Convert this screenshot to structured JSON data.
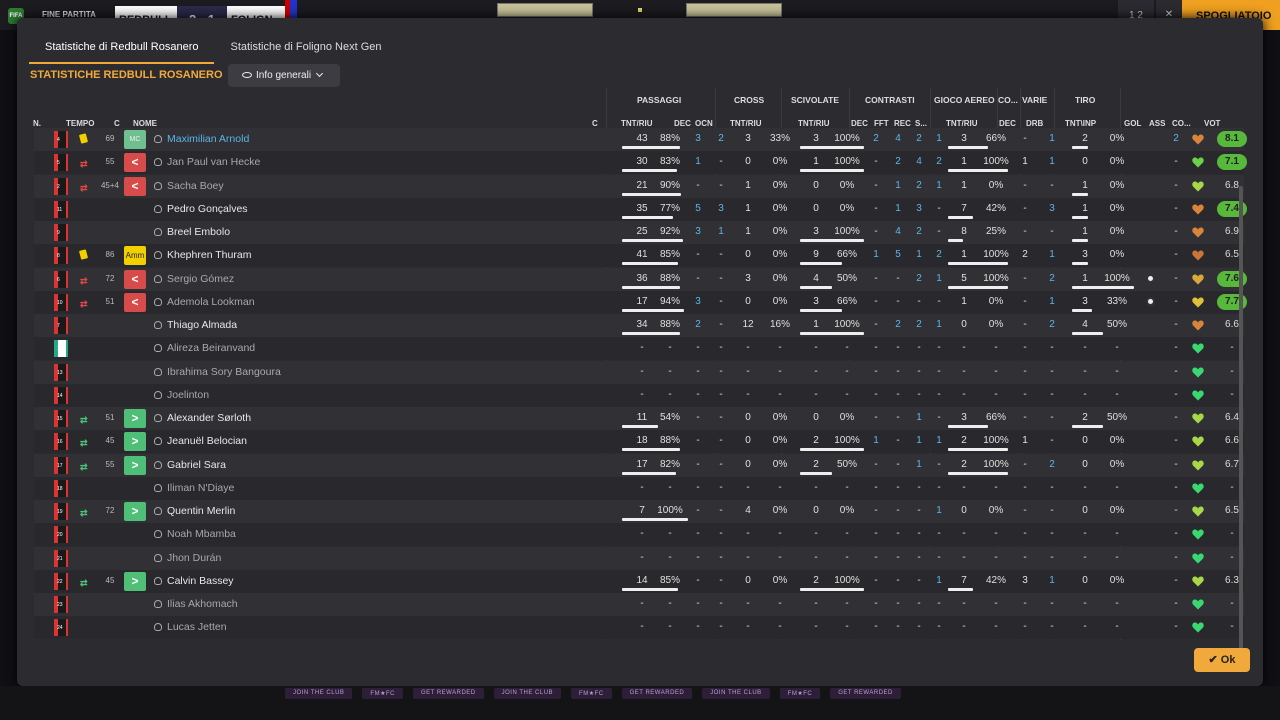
{
  "topbar": {
    "logo": "FIFA",
    "status": "FINE PARTITA",
    "team_a": "REDBULL",
    "score": "2 - 1",
    "team_b": "FOLIGN",
    "btn1": "1 2",
    "btn2": "✕",
    "btn3": "SPOGLIATOIO"
  },
  "tabs": [
    "Statistiche di Redbull Rosanero",
    "Statistiche di Foligno Next Gen"
  ],
  "section_title": "STATISTICHE REDBULL ROSANERO",
  "dropdown_label": "Info generali",
  "groups": {
    "passaggi": "PASSAGGI",
    "cross": "CROSS",
    "scivolate": "SCIVOLATE",
    "contrasti": "CONTRASTI",
    "gioco_aereo": "GIOCO AEREO",
    "co": "CO...",
    "varie": "VARIE",
    "tiro": "TIRO"
  },
  "col_headers": {
    "n": "N.",
    "tempo": "TEMPO",
    "c": "C",
    "nome": "NOME",
    "c2": "C",
    "pass_tnt": "TNT/RIU",
    "pass_dec": "DEC",
    "pass_ocn": "OCN",
    "cross_tnt": "TNT/RIU",
    "sciv_tnt": "TNT/RIU",
    "con_dec": "DEC",
    "con_fft": "FFT",
    "con_rec": "REC",
    "con_s": "S...",
    "aer_tnt": "TNT/RIU",
    "co_dec": "DEC",
    "drb": "DRB",
    "tiro_tnt": "TNT\\INP",
    "gol": "GOL",
    "ass": "ASS",
    "co2": "CO...",
    "vot": "VOT"
  },
  "accent_color": "#f2a93b",
  "players": [
    {
      "n": "4",
      "tempo": "69",
      "badge": "MC",
      "badgeType": "mc",
      "card": true,
      "name": "Maximilian Arnold",
      "nameStyle": "cyan",
      "p": [
        "43",
        "88%"
      ],
      "dec": "3",
      "ocn": "2",
      "cr": [
        "3",
        "33%"
      ],
      "sc": [
        "3",
        "100%"
      ],
      "ct": [
        "2",
        "4",
        "2",
        "1"
      ],
      "ae": [
        "3",
        "66%"
      ],
      "codec": "-",
      "drb": "1",
      "ti": [
        "2",
        "0%"
      ],
      "gol": "",
      "ass": "2",
      "heart": "#d8843a",
      "vot": "8.1",
      "votHl": true
    },
    {
      "n": "5",
      "tempo": "55",
      "badge": "<",
      "badgeType": "red",
      "sub": "out",
      "name": "Jan Paul van Hecke",
      "nameStyle": "dim",
      "p": [
        "30",
        "83%"
      ],
      "dec": "1",
      "ocn": "-",
      "cr": [
        "0",
        "0%"
      ],
      "sc": [
        "1",
        "100%"
      ],
      "ct": [
        "-",
        "2",
        "4",
        "2"
      ],
      "ae": [
        "1",
        "100%"
      ],
      "codec": "1",
      "drb": "1",
      "ti": [
        "0",
        "0%"
      ],
      "gol": "",
      "ass": "-",
      "heart": "#6ad24a",
      "vot": "7.1",
      "votHl": true
    },
    {
      "n": "2",
      "tempo": "45+4",
      "badge": "<",
      "badgeType": "red",
      "sub": "out",
      "name": "Sacha Boey",
      "nameStyle": "dim",
      "p": [
        "21",
        "90%"
      ],
      "dec": "-",
      "ocn": "-",
      "cr": [
        "1",
        "0%"
      ],
      "sc": [
        "0",
        "0%"
      ],
      "ct": [
        "-",
        "1",
        "2",
        "1"
      ],
      "ae": [
        "1",
        "0%"
      ],
      "codec": "-",
      "drb": "-",
      "ti": [
        "1",
        "0%"
      ],
      "gol": "",
      "ass": "-",
      "heart": "#a8d848",
      "vot": "6.8",
      "votHl": false
    },
    {
      "n": "11",
      "tempo": "",
      "badge": "",
      "badgeType": "",
      "name": "Pedro Gonçalves",
      "nameStyle": "",
      "p": [
        "35",
        "77%"
      ],
      "dec": "5",
      "ocn": "3",
      "cr": [
        "1",
        "0%"
      ],
      "sc": [
        "0",
        "0%"
      ],
      "ct": [
        "-",
        "1",
        "3",
        "-"
      ],
      "ae": [
        "7",
        "42%"
      ],
      "codec": "-",
      "drb": "3",
      "ti": [
        "1",
        "0%"
      ],
      "gol": "",
      "ass": "-",
      "heart": "#d8843a",
      "vot": "7.4",
      "votHl": true
    },
    {
      "n": "9",
      "tempo": "",
      "badge": "",
      "badgeType": "",
      "name": "Breel Embolo",
      "nameStyle": "",
      "p": [
        "25",
        "92%"
      ],
      "dec": "3",
      "ocn": "1",
      "cr": [
        "1",
        "0%"
      ],
      "sc": [
        "3",
        "100%"
      ],
      "ct": [
        "-",
        "4",
        "2",
        "-"
      ],
      "ae": [
        "8",
        "25%"
      ],
      "codec": "-",
      "drb": "-",
      "ti": [
        "1",
        "0%"
      ],
      "gol": "",
      "ass": "-",
      "heart": "#d8843a",
      "vot": "6.9",
      "votHl": false
    },
    {
      "n": "8",
      "tempo": "86",
      "badge": "Amm",
      "badgeType": "yel",
      "card": true,
      "name": "Khephren Thuram",
      "nameStyle": "",
      "p": [
        "41",
        "85%"
      ],
      "dec": "-",
      "ocn": "-",
      "cr": [
        "0",
        "0%"
      ],
      "sc": [
        "9",
        "66%"
      ],
      "ct": [
        "1",
        "5",
        "1",
        "2"
      ],
      "ae": [
        "1",
        "100%"
      ],
      "codec": "2",
      "drb": "1",
      "ti": [
        "3",
        "0%"
      ],
      "gol": "",
      "ass": "-",
      "heart": "#c8743a",
      "vot": "6.5",
      "votHl": false
    },
    {
      "n": "6",
      "tempo": "72",
      "badge": "<",
      "badgeType": "red",
      "sub": "out",
      "name": "Sergio Gómez",
      "nameStyle": "dim",
      "p": [
        "36",
        "88%"
      ],
      "dec": "-",
      "ocn": "-",
      "cr": [
        "3",
        "0%"
      ],
      "sc": [
        "4",
        "50%"
      ],
      "ct": [
        "-",
        "-",
        "2",
        "1"
      ],
      "ae": [
        "5",
        "100%"
      ],
      "codec": "-",
      "drb": "2",
      "ti": [
        "1",
        "100%"
      ],
      "gol": "ball",
      "ass": "-",
      "heart": "#d8a83a",
      "vot": "7.6",
      "votHl": true
    },
    {
      "n": "10",
      "tempo": "51",
      "badge": "<",
      "badgeType": "red",
      "sub": "out",
      "name": "Ademola Lookman",
      "nameStyle": "dim",
      "p": [
        "17",
        "94%"
      ],
      "dec": "3",
      "ocn": "-",
      "cr": [
        "0",
        "0%"
      ],
      "sc": [
        "3",
        "66%"
      ],
      "ct": [
        "-",
        "-",
        "-",
        "-"
      ],
      "ae": [
        "1",
        "0%"
      ],
      "codec": "-",
      "drb": "1",
      "ti": [
        "3",
        "33%"
      ],
      "gol": "ball",
      "ass": "-",
      "heart": "#e0c03a",
      "vot": "7.7",
      "votHl": true
    },
    {
      "n": "7",
      "tempo": "",
      "badge": "",
      "badgeType": "",
      "name": "Thiago Almada",
      "nameStyle": "",
      "p": [
        "34",
        "88%"
      ],
      "dec": "2",
      "ocn": "-",
      "cr": [
        "12",
        "16%"
      ],
      "sc": [
        "1",
        "100%"
      ],
      "ct": [
        "-",
        "2",
        "2",
        "1"
      ],
      "ae": [
        "0",
        "0%"
      ],
      "codec": "-",
      "drb": "2",
      "ti": [
        "4",
        "50%"
      ],
      "gol": "",
      "ass": "-",
      "heart": "#d8843a",
      "vot": "6.6",
      "votHl": false
    },
    {
      "n": "12",
      "gk": true,
      "tempo": "",
      "badge": "",
      "badgeType": "",
      "name": "Alireza Beiranvand",
      "nameStyle": "dim",
      "p": [
        "-",
        "-"
      ],
      "dec": "-",
      "ocn": "-",
      "cr": [
        "-",
        "-"
      ],
      "sc": [
        "-",
        "-"
      ],
      "ct": [
        "-",
        "-",
        "-",
        "-"
      ],
      "ae": [
        "-",
        "-"
      ],
      "codec": "-",
      "drb": "-",
      "ti": [
        "-",
        "-"
      ],
      "gol": "",
      "ass": "-",
      "heart": "#3ad870",
      "vot": "-",
      "votHl": false
    },
    {
      "n": "13",
      "tempo": "",
      "badge": "",
      "badgeType": "",
      "name": "Ibrahima Sory Bangoura",
      "nameStyle": "dim",
      "p": [
        "-",
        "-"
      ],
      "dec": "-",
      "ocn": "-",
      "cr": [
        "-",
        "-"
      ],
      "sc": [
        "-",
        "-"
      ],
      "ct": [
        "-",
        "-",
        "-",
        "-"
      ],
      "ae": [
        "-",
        "-"
      ],
      "codec": "-",
      "drb": "-",
      "ti": [
        "-",
        "-"
      ],
      "gol": "",
      "ass": "-",
      "heart": "#3ad870",
      "vot": "-",
      "votHl": false
    },
    {
      "n": "14",
      "tempo": "",
      "badge": "",
      "badgeType": "",
      "name": "Joelinton",
      "nameStyle": "dim",
      "p": [
        "-",
        "-"
      ],
      "dec": "-",
      "ocn": "-",
      "cr": [
        "-",
        "-"
      ],
      "sc": [
        "-",
        "-"
      ],
      "ct": [
        "-",
        "-",
        "-",
        "-"
      ],
      "ae": [
        "-",
        "-"
      ],
      "codec": "-",
      "drb": "-",
      "ti": [
        "-",
        "-"
      ],
      "gol": "",
      "ass": "-",
      "heart": "#3ad870",
      "vot": "-",
      "votHl": false
    },
    {
      "n": "15",
      "tempo": "51",
      "badge": ">",
      "badgeType": "green",
      "sub": "in",
      "name": "Alexander Sørloth",
      "nameStyle": "",
      "p": [
        "11",
        "54%"
      ],
      "dec": "-",
      "ocn": "-",
      "cr": [
        "0",
        "0%"
      ],
      "sc": [
        "0",
        "0%"
      ],
      "ct": [
        "-",
        "-",
        "1",
        "-"
      ],
      "ae": [
        "3",
        "66%"
      ],
      "codec": "-",
      "drb": "-",
      "ti": [
        "2",
        "50%"
      ],
      "gol": "",
      "ass": "-",
      "heart": "#a8d848",
      "vot": "6.4",
      "votHl": false
    },
    {
      "n": "16",
      "tempo": "45",
      "badge": ">",
      "badgeType": "green",
      "sub": "in",
      "name": "Jeanuël Belocian",
      "nameStyle": "",
      "p": [
        "18",
        "88%"
      ],
      "dec": "-",
      "ocn": "-",
      "cr": [
        "0",
        "0%"
      ],
      "sc": [
        "2",
        "100%"
      ],
      "ct": [
        "1",
        "-",
        "1",
        "1"
      ],
      "ae": [
        "2",
        "100%"
      ],
      "codec": "1",
      "drb": "-",
      "ti": [
        "0",
        "0%"
      ],
      "gol": "",
      "ass": "-",
      "heart": "#a8d848",
      "vot": "6.6",
      "votHl": false
    },
    {
      "n": "17",
      "tempo": "55",
      "badge": ">",
      "badgeType": "green",
      "sub": "in",
      "name": "Gabriel Sara",
      "nameStyle": "",
      "p": [
        "17",
        "82%"
      ],
      "dec": "-",
      "ocn": "-",
      "cr": [
        "0",
        "0%"
      ],
      "sc": [
        "2",
        "50%"
      ],
      "ct": [
        "-",
        "-",
        "1",
        "-"
      ],
      "ae": [
        "2",
        "100%"
      ],
      "codec": "-",
      "drb": "2",
      "ti": [
        "0",
        "0%"
      ],
      "gol": "",
      "ass": "-",
      "heart": "#a8d848",
      "vot": "6.7",
      "votHl": false
    },
    {
      "n": "18",
      "tempo": "",
      "badge": "",
      "badgeType": "",
      "name": "Iliman N'Diaye",
      "nameStyle": "dim",
      "p": [
        "-",
        "-"
      ],
      "dec": "-",
      "ocn": "-",
      "cr": [
        "-",
        "-"
      ],
      "sc": [
        "-",
        "-"
      ],
      "ct": [
        "-",
        "-",
        "-",
        "-"
      ],
      "ae": [
        "-",
        "-"
      ],
      "codec": "-",
      "drb": "-",
      "ti": [
        "-",
        "-"
      ],
      "gol": "",
      "ass": "-",
      "heart": "#3ad870",
      "vot": "-",
      "votHl": false
    },
    {
      "n": "19",
      "tempo": "72",
      "badge": ">",
      "badgeType": "green",
      "sub": "in",
      "name": "Quentin Merlin",
      "nameStyle": "",
      "p": [
        "7",
        "100%"
      ],
      "dec": "-",
      "ocn": "-",
      "cr": [
        "4",
        "0%"
      ],
      "sc": [
        "0",
        "0%"
      ],
      "ct": [
        "-",
        "-",
        "-",
        "1"
      ],
      "ae": [
        "0",
        "0%"
      ],
      "codec": "-",
      "drb": "-",
      "ti": [
        "0",
        "0%"
      ],
      "gol": "",
      "ass": "-",
      "heart": "#a8d848",
      "vot": "6.5",
      "votHl": false
    },
    {
      "n": "20",
      "tempo": "",
      "badge": "",
      "badgeType": "",
      "name": "Noah Mbamba",
      "nameStyle": "dim",
      "p": [
        "-",
        "-"
      ],
      "dec": "-",
      "ocn": "-",
      "cr": [
        "-",
        "-"
      ],
      "sc": [
        "-",
        "-"
      ],
      "ct": [
        "-",
        "-",
        "-",
        "-"
      ],
      "ae": [
        "-",
        "-"
      ],
      "codec": "-",
      "drb": "-",
      "ti": [
        "-",
        "-"
      ],
      "gol": "",
      "ass": "-",
      "heart": "#3ad870",
      "vot": "-",
      "votHl": false
    },
    {
      "n": "21",
      "tempo": "",
      "badge": "",
      "badgeType": "",
      "name": "Jhon Durán",
      "nameStyle": "dim",
      "p": [
        "-",
        "-"
      ],
      "dec": "-",
      "ocn": "-",
      "cr": [
        "-",
        "-"
      ],
      "sc": [
        "-",
        "-"
      ],
      "ct": [
        "-",
        "-",
        "-",
        "-"
      ],
      "ae": [
        "-",
        "-"
      ],
      "codec": "-",
      "drb": "-",
      "ti": [
        "-",
        "-"
      ],
      "gol": "",
      "ass": "-",
      "heart": "#3ad870",
      "vot": "-",
      "votHl": false
    },
    {
      "n": "22",
      "tempo": "45",
      "badge": ">",
      "badgeType": "green",
      "sub": "in",
      "name": "Calvin Bassey",
      "nameStyle": "",
      "p": [
        "14",
        "85%"
      ],
      "dec": "-",
      "ocn": "-",
      "cr": [
        "0",
        "0%"
      ],
      "sc": [
        "2",
        "100%"
      ],
      "ct": [
        "-",
        "-",
        "-",
        "1"
      ],
      "ae": [
        "7",
        "42%"
      ],
      "codec": "3",
      "drb": "1",
      "ti": [
        "0",
        "0%"
      ],
      "gol": "",
      "ass": "-",
      "heart": "#a8d848",
      "vot": "6.3",
      "votHl": false
    },
    {
      "n": "23",
      "tempo": "",
      "badge": "",
      "badgeType": "",
      "name": "Ilias Akhomach",
      "nameStyle": "dim",
      "p": [
        "-",
        "-"
      ],
      "dec": "-",
      "ocn": "-",
      "cr": [
        "-",
        "-"
      ],
      "sc": [
        "-",
        "-"
      ],
      "ct": [
        "-",
        "-",
        "-",
        "-"
      ],
      "ae": [
        "-",
        "-"
      ],
      "codec": "-",
      "drb": "-",
      "ti": [
        "-",
        "-"
      ],
      "gol": "",
      "ass": "-",
      "heart": "#3ad870",
      "vot": "-",
      "votHl": false
    },
    {
      "n": "24",
      "tempo": "",
      "badge": "",
      "badgeType": "",
      "name": "Lucas Jetten",
      "nameStyle": "dim",
      "p": [
        "-",
        "-"
      ],
      "dec": "-",
      "ocn": "-",
      "cr": [
        "-",
        "-"
      ],
      "sc": [
        "-",
        "-"
      ],
      "ct": [
        "-",
        "-",
        "-",
        "-"
      ],
      "ae": [
        "-",
        "-"
      ],
      "codec": "-",
      "drb": "-",
      "ti": [
        "-",
        "-"
      ],
      "gol": "",
      "ass": "-",
      "heart": "#3ad870",
      "vot": "-",
      "votHl": false
    }
  ],
  "ok_label": "Ok",
  "ticker": [
    "JOIN THE CLUB",
    "FM★FC",
    "GET REWARDED",
    "JOIN THE CLUB",
    "FM★FC",
    "GET REWARDED",
    "JOIN THE CLUB",
    "FM★FC",
    "GET REWARDED"
  ]
}
